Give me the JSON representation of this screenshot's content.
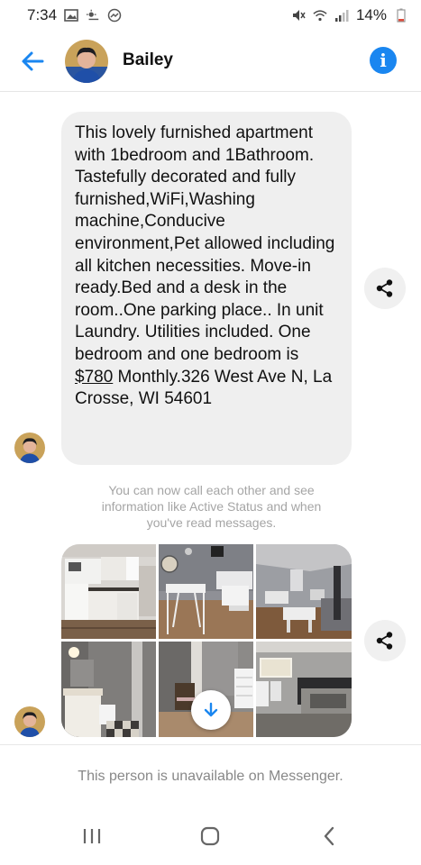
{
  "status_bar": {
    "time": "7:34",
    "battery": "14%",
    "left_icons": [
      "gallery-icon",
      "weather-icon",
      "messenger-icon"
    ],
    "right_icons": [
      "mute-icon",
      "wifi-icon",
      "signal-icon",
      "battery-icon"
    ]
  },
  "header": {
    "contact_name": "Bailey"
  },
  "conversation": {
    "message": {
      "text_before": "This lovely furnished apartment with 1bedroom and 1Bathroom. Tastefully decorated and fully furnished,WiFi,Washing machine,Conducive environment,Pet allowed including all kitchen necessities. Move-in ready.Bed and a desk in the room..One parking place.. In unit Laundry. Utilities included.  One bedroom and one bedroom is ",
      "price_link": "$780",
      "text_after": " Monthly.326 West Ave N, La Crosse, WI 54601"
    },
    "system_message": "You can now call each other and see information like Active Status and when you've read messages.",
    "photos": [
      "kitchen",
      "dining-living",
      "basement-living",
      "bathroom",
      "hallway-room",
      "bedroom"
    ]
  },
  "footer": {
    "unavailable_text": "This person is unavailable on Messenger."
  },
  "colors": {
    "accent": "#1a86f0",
    "bubble": "#efefef",
    "muted": "#a5a5a5"
  }
}
